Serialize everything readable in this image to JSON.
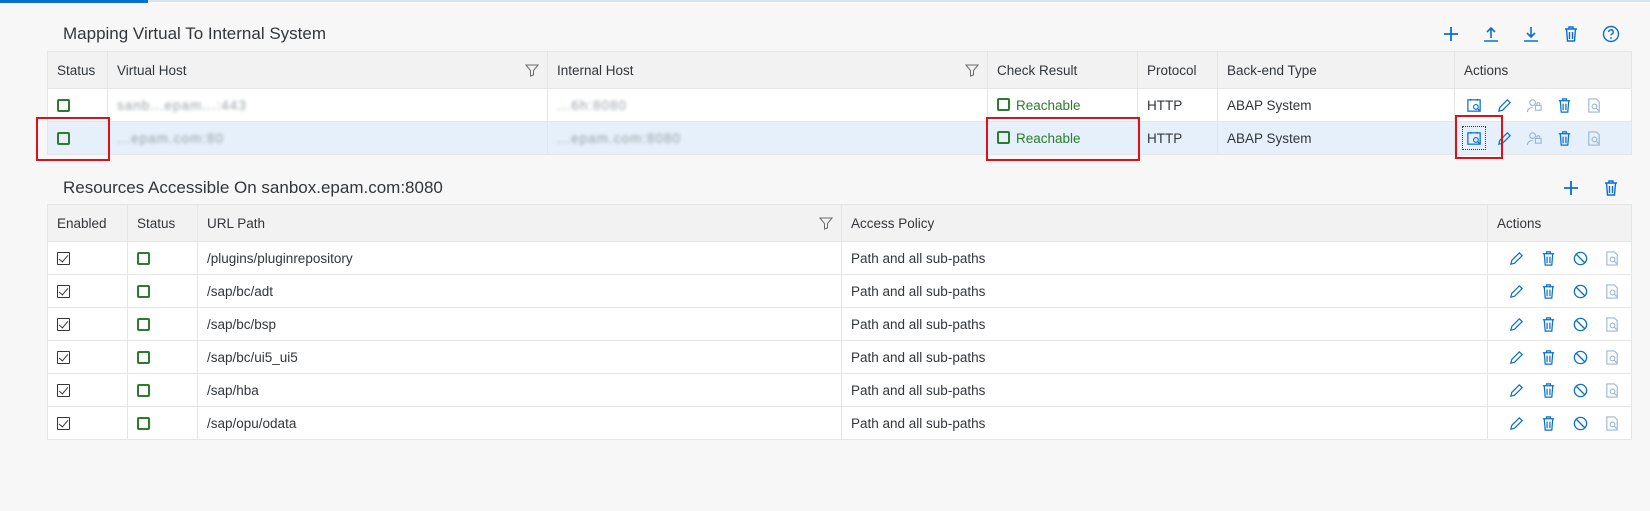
{
  "mapping": {
    "title": "Mapping Virtual To Internal System",
    "toolbar": [
      "add-icon",
      "upload-icon",
      "download-icon",
      "delete-icon",
      "help-icon"
    ],
    "columns": [
      "Status",
      "Virtual Host",
      "Internal Host",
      "Check Result",
      "Protocol",
      "Back-end Type",
      "Actions"
    ],
    "rows": [
      {
        "virtual_host": "sanb...epam...:443",
        "internal_host": "...6h:8080",
        "check_result": "Reachable",
        "protocol": "HTTP",
        "backend_type": "ABAP System"
      },
      {
        "virtual_host": "...epam.com:80",
        "internal_host": "...epam.com:8080",
        "check_result": "Reachable",
        "protocol": "HTTP",
        "backend_type": "ABAP System"
      }
    ]
  },
  "resources": {
    "title": "Resources Accessible On sanbox.epam.com:8080",
    "toolbar": [
      "add-icon",
      "delete-icon"
    ],
    "columns": [
      "Enabled",
      "Status",
      "URL Path",
      "Access Policy",
      "Actions"
    ],
    "rows": [
      {
        "url_path": "/plugins/pluginrepository",
        "access_policy": "Path and all sub-paths"
      },
      {
        "url_path": "/sap/bc/adt",
        "access_policy": "Path and all sub-paths"
      },
      {
        "url_path": "/sap/bc/bsp",
        "access_policy": "Path and all sub-paths"
      },
      {
        "url_path": "/sap/bc/ui5_ui5",
        "access_policy": "Path and all sub-paths"
      },
      {
        "url_path": "/sap/hba",
        "access_policy": "Path and all sub-paths"
      },
      {
        "url_path": "/sap/opu/odata",
        "access_policy": "Path and all sub-paths"
      }
    ]
  },
  "colors": {
    "accent": "#0a6ed1",
    "positive": "#2b7d2b",
    "highlight": "#e0101a",
    "selected_row": "#e5f0fa"
  }
}
